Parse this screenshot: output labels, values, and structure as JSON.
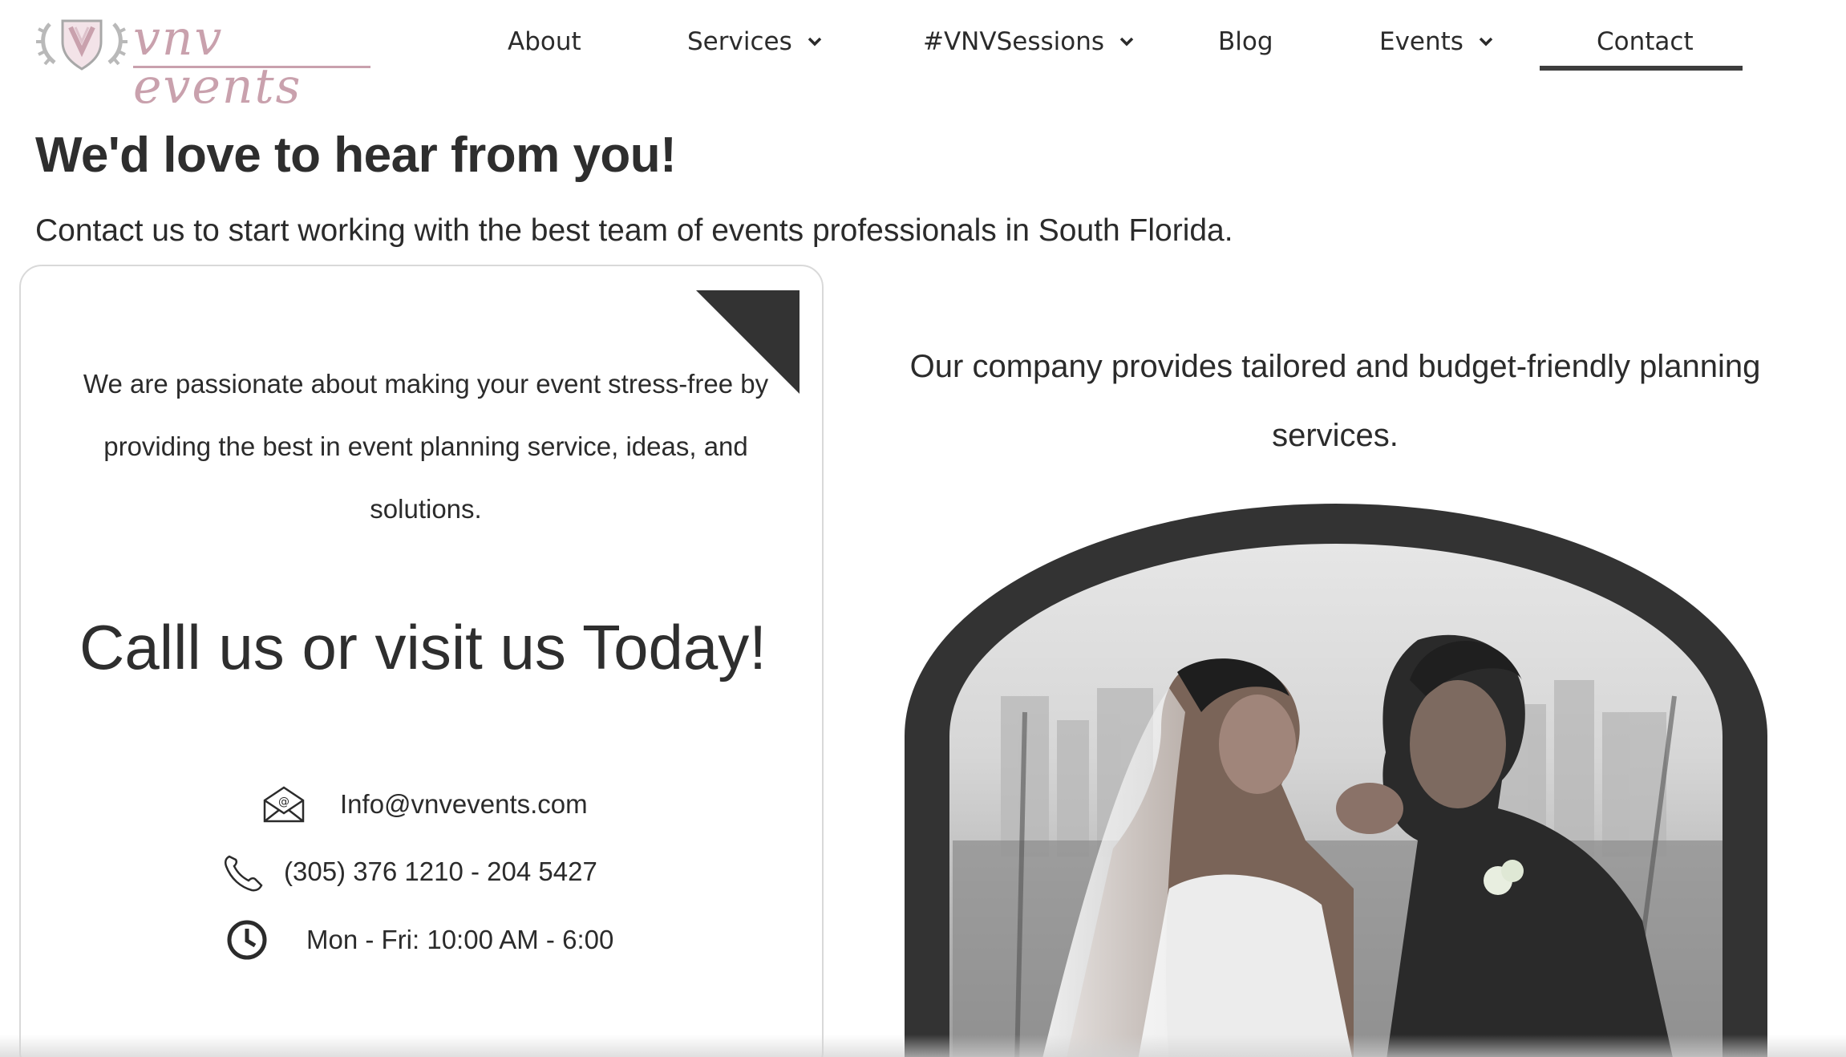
{
  "brand": {
    "logo_text": "vnv events",
    "accent": "#c9a1ad"
  },
  "nav": {
    "items": [
      {
        "label": "About",
        "has_dropdown": false
      },
      {
        "label": "Services",
        "has_dropdown": true
      },
      {
        "label": "#VNVSessions",
        "has_dropdown": true
      },
      {
        "label": "Blog",
        "has_dropdown": false
      },
      {
        "label": "Events",
        "has_dropdown": true
      },
      {
        "label": "Contact",
        "has_dropdown": false,
        "active": true
      }
    ]
  },
  "hero": {
    "title": "We'd love to hear from you!",
    "subtitle": "Contact us to start working with the best team of events professionals in South Florida."
  },
  "card": {
    "intro": "We are passionate about making your event stress-free by providing the best in event planning service, ideas, and solutions.",
    "heading": "Calll us or visit us Today!",
    "contacts": [
      {
        "icon": "envelope-icon",
        "text": "Info@vnvevents.com"
      },
      {
        "icon": "phone-icon",
        "text": "(305) 376 1210 - 204 5427"
      },
      {
        "icon": "clock-icon",
        "text": "Mon - Fri: 10:00 AM - 6:00"
      }
    ]
  },
  "right": {
    "text": "Our company provides tailored and budget-friendly planning services.",
    "photo": "wedding-couple-photo"
  },
  "colors": {
    "text": "#2b2b2b",
    "dark": "#333333",
    "border": "#d9d9d9"
  }
}
